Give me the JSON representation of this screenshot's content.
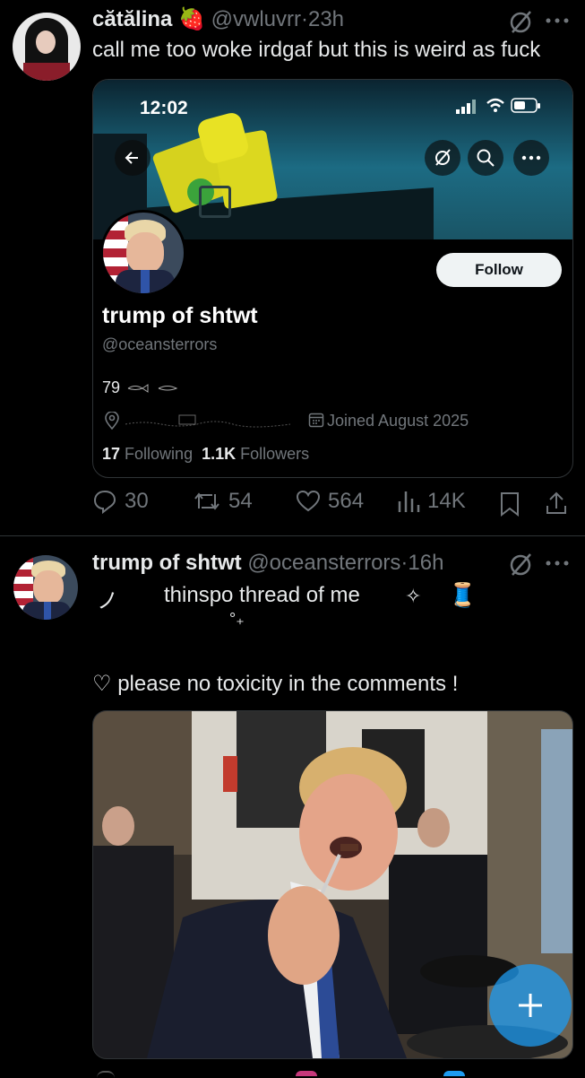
{
  "tweet1": {
    "name": "cătălina",
    "handle": "@vwluvrr",
    "sep": "·",
    "time": "23h",
    "text": "call me too woke irdgaf but this is weird as fuck",
    "emoji": "🍓",
    "stats": {
      "replies": "30",
      "retweets": "54",
      "likes": "564",
      "views": "14K"
    }
  },
  "embed": {
    "status_time": "12:02",
    "display_name": "trump of shtwt",
    "handle": "@oceansterrors",
    "bio": "79",
    "joined": "Joined August 2025",
    "following_count": "17",
    "following_label": "Following",
    "followers_count": "1.1K",
    "followers_label": "Followers",
    "follow_label": "Follow"
  },
  "tweet2": {
    "name": "trump of shtwt",
    "handle": "@oceansterrors",
    "sep": "·",
    "time": "16h",
    "line1_a": "ノ",
    "line1_b": "thinspo thread of me",
    "line1_c": "✧",
    "line1_d": "🧵",
    "line2": "°₊",
    "line3_icon": "♡",
    "line3": "please no toxicity in the comments !"
  },
  "colors": {
    "accent": "#1d9bf0",
    "muted": "#71767b",
    "text": "#e7e9ea",
    "bg": "#000000"
  }
}
